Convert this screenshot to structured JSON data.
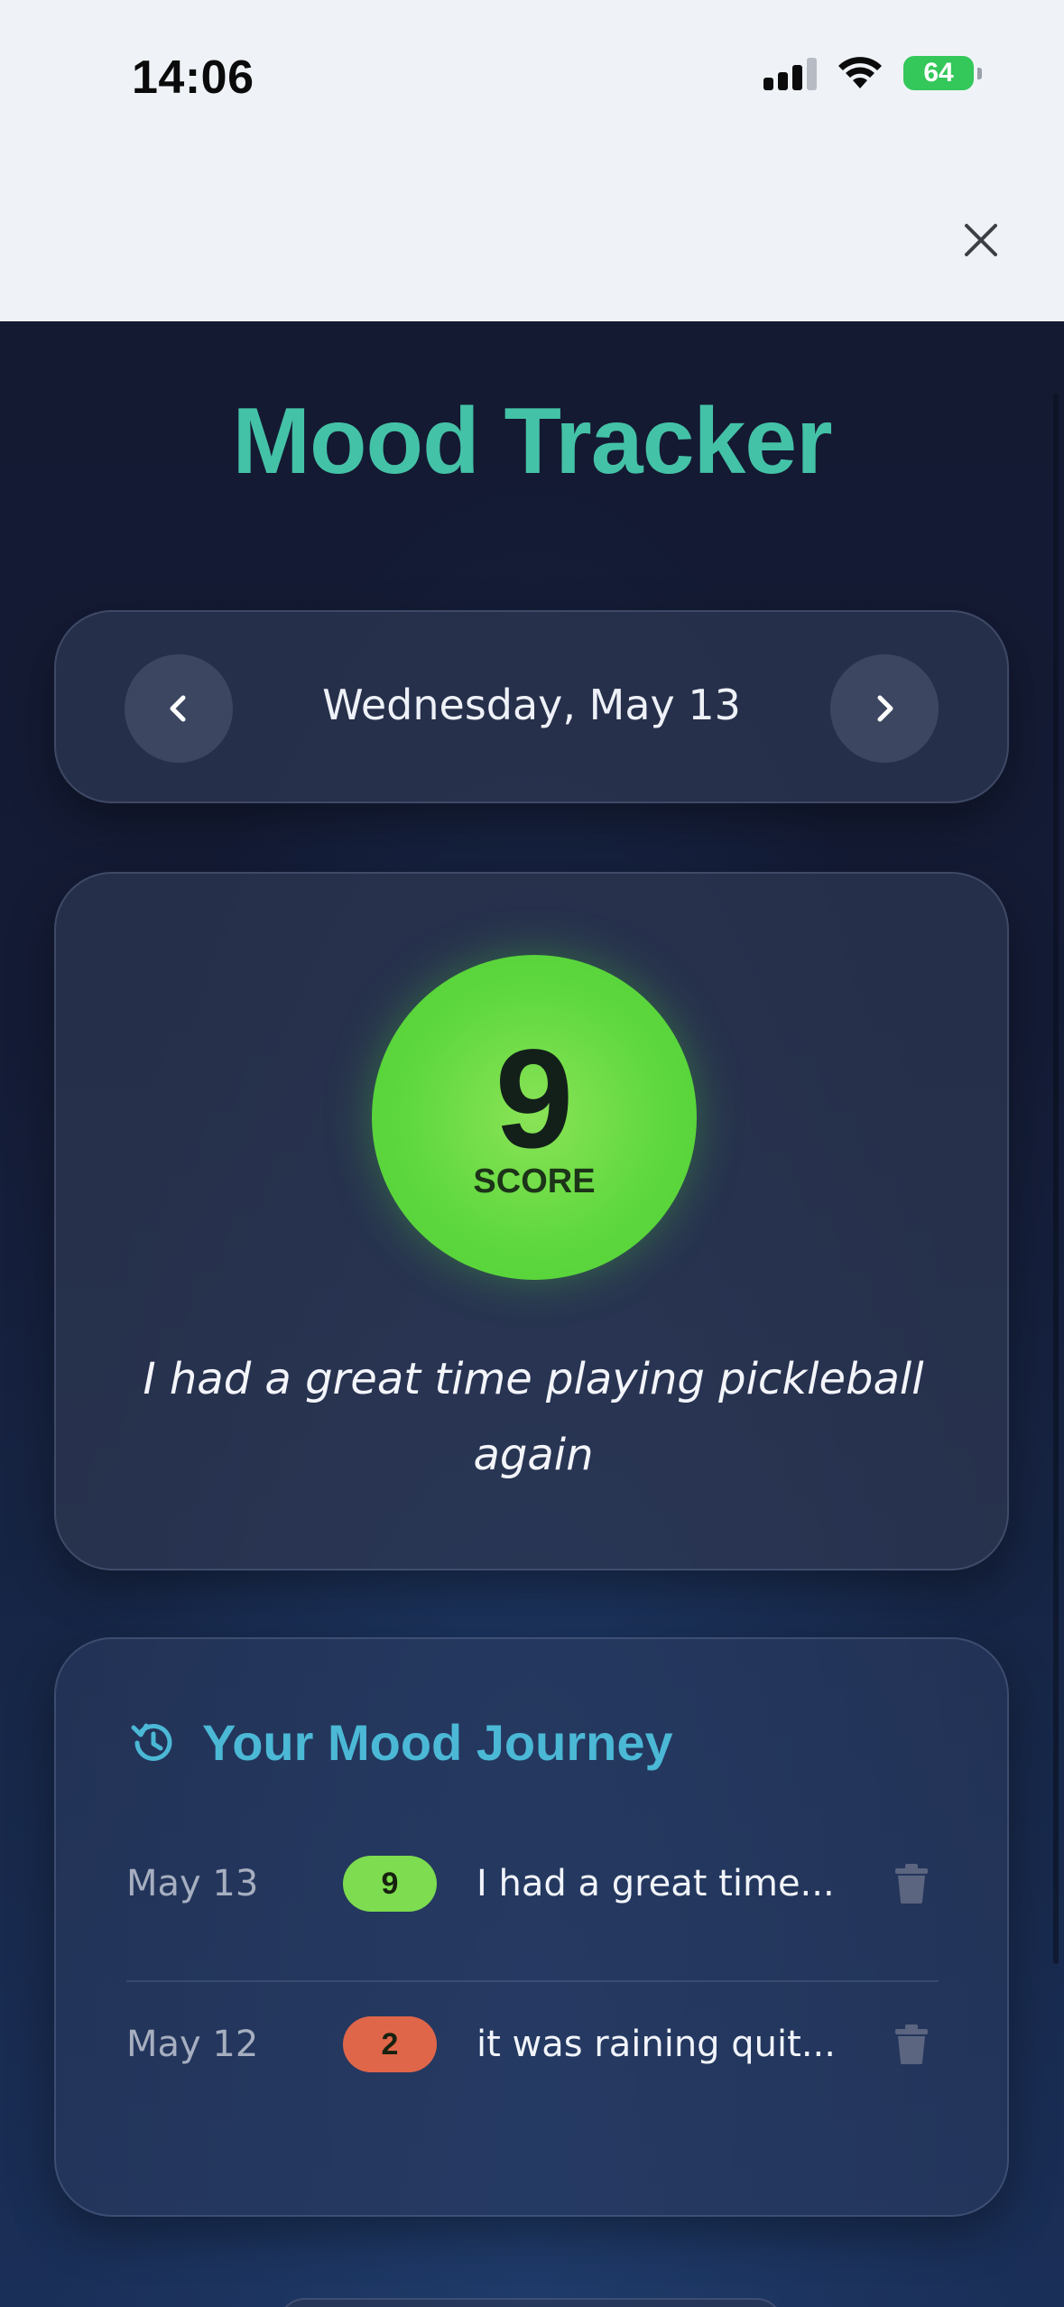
{
  "status_bar": {
    "time": "14:06",
    "battery": "64",
    "icons": [
      "cellular-signal-icon",
      "wifi-icon",
      "battery-charging-icon"
    ]
  },
  "sheet": {
    "close_icon": "close-icon"
  },
  "app": {
    "title": "Mood Tracker",
    "title_color": "#44c2a7"
  },
  "date_nav": {
    "date": "Wednesday, May 13",
    "prev_icon": "chevron-left-icon",
    "next_icon": "chevron-right-icon"
  },
  "today_entry": {
    "score": "9",
    "score_label": "SCORE",
    "score_color": "#5fd83f",
    "note": "I had a great time playing pickleball again"
  },
  "journey": {
    "title": "Your Mood Journey",
    "icon": "history-icon",
    "title_color": "#4bb8d6",
    "entries": [
      {
        "date": "May 13",
        "score": "9",
        "badge_color": "#7ddc4f",
        "text": "I had a great time...",
        "action_icon": "trash-icon"
      },
      {
        "date": "May 12",
        "score": "2",
        "badge_color": "#e0664a",
        "text": "it was raining quit...",
        "action_icon": "trash-icon"
      }
    ]
  }
}
